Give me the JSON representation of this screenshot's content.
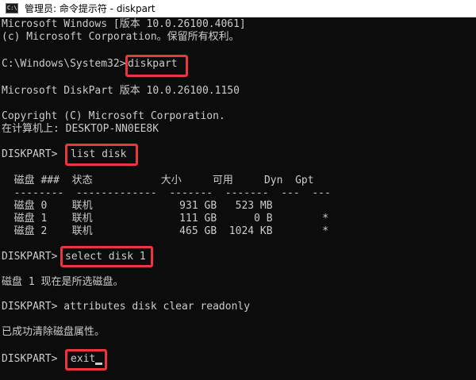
{
  "window": {
    "icon_name": "cmd-console-icon",
    "icon_glyph": "C:\\",
    "title": "管理员: 命令提示符 - diskpart"
  },
  "console": {
    "header1": "Microsoft Windows [版本 10.0.26100.4061]",
    "header2": "(c) Microsoft Corporation。保留所有权利。",
    "prompt1": "C:\\Windows\\System32>",
    "cmd1": "diskpart",
    "dp_version": "Microsoft DiskPart 版本 10.0.26100.1150",
    "copyright": "Copyright (C) Microsoft Corporation.",
    "computer": "在计算机上: DESKTOP-NN0EE8K",
    "prompt2": "DISKPART>",
    "cmd2": "list disk",
    "table_header": "  磁盘 ###  状态           大小     可用     Dyn  Gpt",
    "table_rule": "  --------  -------------  -------  -------  ---  ---",
    "rows": [
      "  磁盘 0    联机              931 GB   523 MB",
      "  磁盘 1    联机              111 GB      0 B        *",
      "  磁盘 2    联机              465 GB  1024 KB        *"
    ],
    "prompt3": "DISKPART>",
    "cmd3": "select disk 1",
    "msg_selected": "磁盘 1 现在是所选磁盘。",
    "line_attr": "DISKPART> attributes disk clear readonly",
    "msg_cleared": "已成功清除磁盘属性。",
    "prompt4": "DISKPART>",
    "cmd4": "exit"
  },
  "colors": {
    "console_bg": "#0c0c0c",
    "console_text": "#cccccc",
    "highlight": "#e8383d"
  }
}
